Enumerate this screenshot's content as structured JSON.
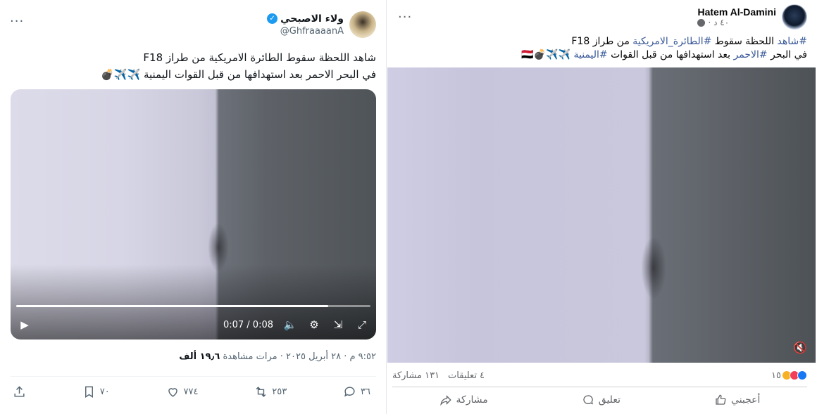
{
  "x_post": {
    "more_label": "···",
    "author_name": "ولاء الاصبحي",
    "verified_glyph": "✓",
    "handle": "@GhfraaaanA",
    "text_line1": "شاهد اللحظة سقوط الطائرة الامريكية من طراز F18",
    "text_line2": "في البحر الاحمر بعد استهدافها من قبل القوات اليمنية ✈️✈️💣",
    "video": {
      "time": "0:07 / 0:08",
      "progress_fraction": 0.88,
      "play_glyph": "▶",
      "volume_glyph": "🔈",
      "settings_glyph": "⚙",
      "pip_glyph": "⇲",
      "fullscreen_glyph": "⤢"
    },
    "meta": {
      "time": "٩:٥٢ م",
      "date": "٢٨ أبريل ٢٠٢٥",
      "views_count": "١٩٫٦ ألف",
      "views_label": "مرات مشاهدة",
      "separator": "·"
    },
    "actions": {
      "replies": "٣٦",
      "reposts": "٢٥٣",
      "likes": "٧٧٤",
      "bookmarks": "٧٠"
    }
  },
  "fb_post": {
    "more_label": "···",
    "author_name": "Hatem Al-Damini",
    "time_label": "٤٠ د ·",
    "text_line1_tag1": "#شاهد",
    "text_line1_plain": " اللحظة سقوط ",
    "text_line1_tag2": "#الطائرة_الامريكية",
    "text_line1_rest": " من طراز F18",
    "text_line2_plain1": "في البحر ",
    "text_line2_tag1": "#الاحمر",
    "text_line2_plain2": " بعد استهدافها من قبل القوات ",
    "text_line2_tag2": "#اليمنية",
    "text_line2_emoji": " ✈️✈️💣🇾🇪",
    "mute_glyph": "🔇",
    "stats": {
      "reactions_count": "١٥",
      "comments": "٤ تعليقات",
      "shares": "١٣١ مشاركة"
    },
    "actions": {
      "like": "أعجبني",
      "comment": "تعليق",
      "share": "مشاركة"
    },
    "colors": {
      "hashtag": "#385898",
      "like_reaction": "#1877f2",
      "love_reaction": "#f33e58",
      "haha_reaction": "#f7b125"
    }
  }
}
